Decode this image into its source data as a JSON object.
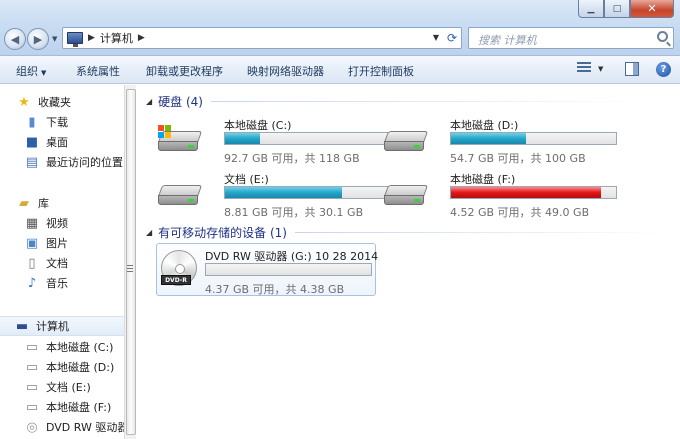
{
  "address": {
    "breadcrumb": "计算机",
    "search_placeholder": "搜索 计算机"
  },
  "toolbar": {
    "organize": "组织",
    "system_properties": "系统属性",
    "uninstall": "卸载或更改程序",
    "map_drive": "映射网络驱动器",
    "control_panel": "打开控制面板"
  },
  "nav": {
    "favorites": "收藏夹",
    "downloads": "下载",
    "desktop": "桌面",
    "recent": "最近访问的位置",
    "libraries": "库",
    "videos": "视频",
    "pictures": "图片",
    "documents": "文档",
    "music": "音乐",
    "computer": "计算机",
    "drive_c": "本地磁盘 (C:)",
    "drive_d": "本地磁盘 (D:)",
    "drive_e": "文档 (E:)",
    "drive_f": "本地磁盘 (F:)",
    "drive_g": "DVD RW 驱动器"
  },
  "groups": {
    "hdd": "硬盘 (4)",
    "removable": "有可移动存储的设备 (1)"
  },
  "drives": [
    {
      "name": "本地磁盘 (C:)",
      "free": "92.7 GB 可用，共 118 GB",
      "used_fraction": 0.214,
      "status": "ok"
    },
    {
      "name": "本地磁盘 (D:)",
      "free": "54.7 GB 可用，共 100 GB",
      "used_fraction": 0.453,
      "status": "ok"
    },
    {
      "name": "文档 (E:)",
      "free": "8.81 GB 可用，共 30.1 GB",
      "used_fraction": 0.707,
      "status": "ok"
    },
    {
      "name": "本地磁盘 (F:)",
      "free": "4.52 GB 可用，共 49.0 GB",
      "used_fraction": 0.908,
      "status": "warn"
    }
  ],
  "dvd": {
    "name": "DVD RW 驱动器 (G:) 10 28 2014",
    "free": "4.37 GB 可用，共 4.38 GB",
    "used_fraction": 0.002,
    "label": "DVD-R"
  },
  "colors": {
    "bar_ok": "#26a6c8",
    "bar_warn": "#e01818",
    "group_title": "#1e3287"
  }
}
